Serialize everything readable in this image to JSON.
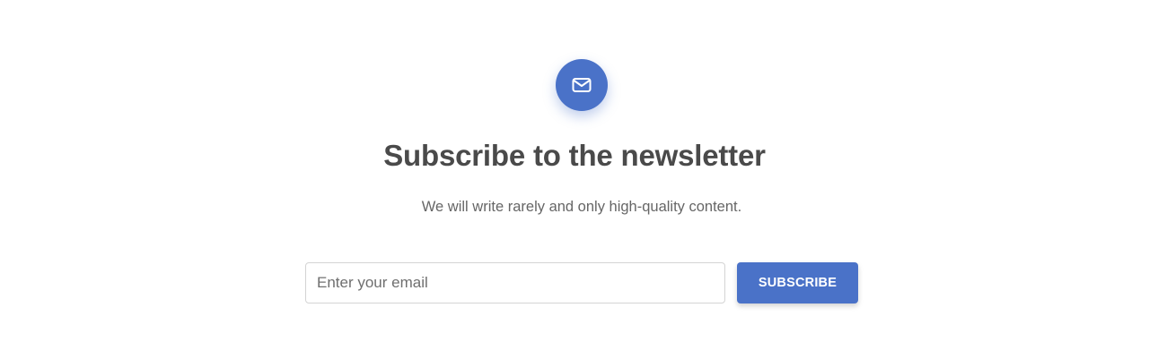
{
  "newsletter": {
    "icon": "envelope-icon",
    "title": "Subscribe to the newsletter",
    "subtitle": "We will write rarely and only high-quality content.",
    "email_placeholder": "Enter your email",
    "email_value": "",
    "subscribe_label": "SUBSCRIBE"
  },
  "colors": {
    "accent": "#4a72c8",
    "title_text": "#4a4a4a",
    "subtitle_text": "#666666",
    "input_border": "#d4d4d4",
    "background": "#ffffff"
  }
}
